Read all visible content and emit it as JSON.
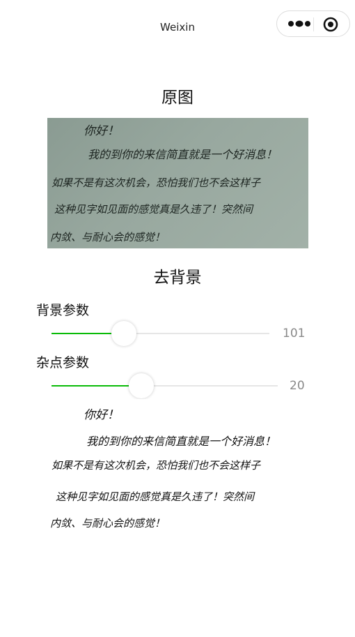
{
  "navbar": {
    "title": "Weixin",
    "menu_icon": "more-dots-icon",
    "home_icon": "target-circle-icon"
  },
  "original": {
    "title": "原图",
    "note_lines": [
      "你好！",
      "我的到你的来信简直就是一个好消息！",
      "如果不是有这次机会，恐怕我们也不会这样子",
      "这种见字如见面的感觉真是久违了！突然间",
      "内敛、与耐心会的感觉！"
    ]
  },
  "background_removal": {
    "title": "去背景",
    "background_param": {
      "label": "背景参数",
      "value": 101,
      "fraction": 0.28
    },
    "noise_param": {
      "label": "杂点参数",
      "value": 20,
      "fraction": 0.34
    }
  },
  "colors": {
    "accent": "#09bb07",
    "photo_bg": "#98a89f"
  }
}
